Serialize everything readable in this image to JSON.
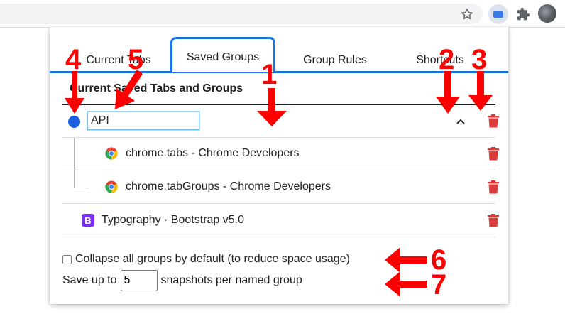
{
  "toolbar": {
    "icons": [
      "star-icon",
      "extension-active-icon",
      "puzzle-icon",
      "avatar"
    ]
  },
  "tabs": [
    {
      "label": "Current Tabs",
      "active": false
    },
    {
      "label": "Saved Groups",
      "active": true
    },
    {
      "label": "Group Rules",
      "active": false
    },
    {
      "label": "Shortcuts",
      "active": false
    }
  ],
  "saved": {
    "title": "Current Saved Tabs and Groups",
    "group": {
      "name_value": "API",
      "dot_color": "#1a5fe0",
      "tabs": [
        {
          "title": "chrome.tabs - Chrome Developers",
          "icon": "chrome-icon"
        },
        {
          "title": "chrome.tabGroups - Chrome Developers",
          "icon": "chrome-icon"
        }
      ]
    },
    "ungrouped": [
      {
        "title": "Typography · Bootstrap v5.0",
        "icon": "bootstrap-icon",
        "icon_letter": "B"
      }
    ]
  },
  "options": {
    "collapse_label": "Collapse all groups by default (to reduce space usage)",
    "collapse_checked": false,
    "snapshots_prefix": "Save up to",
    "snapshots_value": "5",
    "snapshots_suffix": "snapshots per named group"
  },
  "annotations": {
    "color": "#ff0000",
    "numbers": [
      "1",
      "2",
      "3",
      "4",
      "5",
      "6",
      "7"
    ]
  }
}
